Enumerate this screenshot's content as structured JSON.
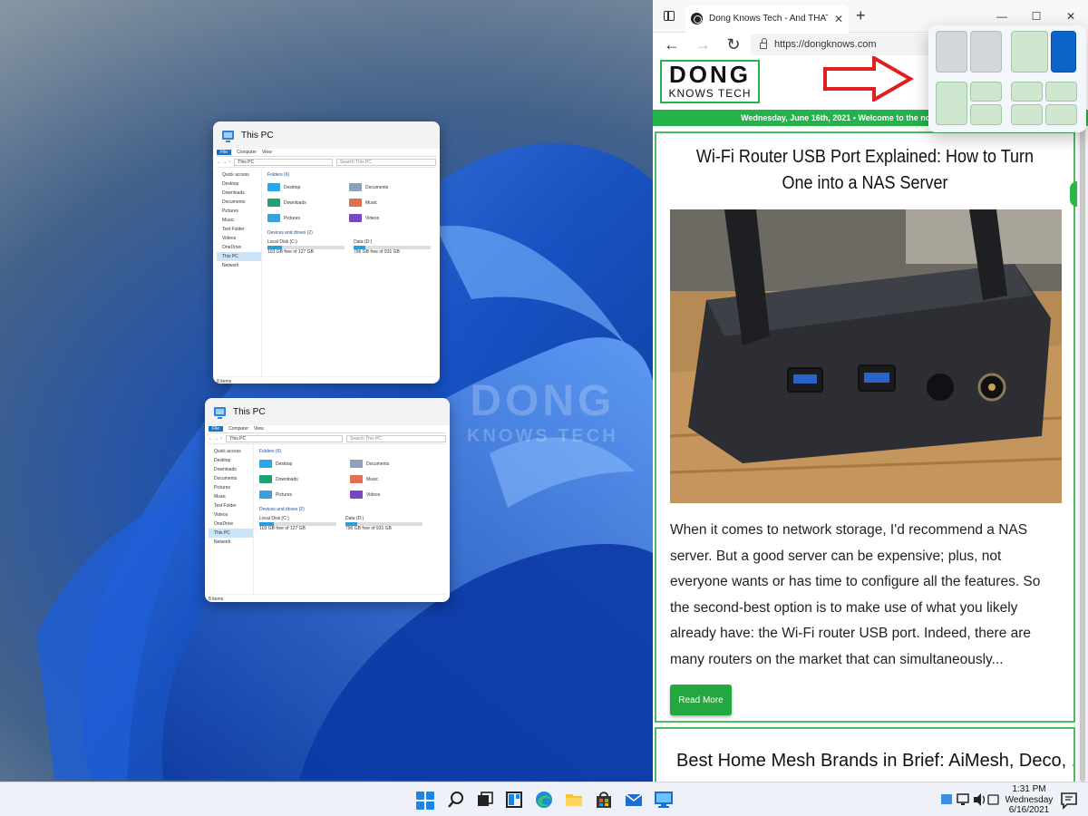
{
  "desktop": {
    "watermark_line1": "DONG",
    "watermark_line2": "KNOWS TECH"
  },
  "explorer_thumbs": [
    {
      "title": "This PC",
      "ribbon": [
        "File",
        "Computer",
        "View"
      ],
      "address": "This PC",
      "search_placeholder": "Search This PC",
      "nav": [
        "Quick access",
        "Desktop",
        "Downloads",
        "Documents",
        "Pictures",
        "Music",
        "Test Folder",
        "Videos",
        "OneDrive",
        "This PC",
        "Network"
      ],
      "folders_header": "Folders (6)",
      "folders": [
        "Desktop",
        "Documents",
        "Downloads",
        "Music",
        "Pictures",
        "Videos"
      ],
      "drives_header": "Devices and drives (2)",
      "drives": [
        {
          "name": "Local Disk (C:)",
          "free": "103 GB free of 127 GB",
          "fill": 0.19
        },
        {
          "name": "Data (D:)",
          "free": "796 GB free of 931 GB",
          "fill": 0.15
        }
      ],
      "status": "8 items"
    },
    {
      "title": "This PC",
      "ribbon": [
        "File",
        "Computer",
        "View"
      ],
      "address": "This PC",
      "search_placeholder": "Search This PC",
      "nav": [
        "Quick access",
        "Desktop",
        "Downloads",
        "Documents",
        "Pictures",
        "Music",
        "Test Folder",
        "Videos",
        "OneDrive",
        "This PC",
        "Network"
      ],
      "folders_header": "Folders (6)",
      "folders": [
        "Desktop",
        "Documents",
        "Downloads",
        "Music",
        "Pictures",
        "Videos"
      ],
      "drives_header": "Devices and drives (2)",
      "drives": [
        {
          "name": "Local Disk (C:)",
          "free": "103 GB free of 127 GB",
          "fill": 0.19
        },
        {
          "name": "Data (D:)",
          "free": "796 GB free of 931 GB",
          "fill": 0.15
        }
      ],
      "status": "8 items"
    }
  ],
  "browser": {
    "tab_title": "Dong Knows Tech - And THAT's a",
    "url": "https://dongknows.com",
    "logo_line1": "DONG",
    "logo_line2": "KNOWS TECH",
    "banner": "Wednesday, June 16th, 2021 • Welcome to the no-nonsense zone! •",
    "article": {
      "title": "Wi-Fi Router USB Port Explained: How to Turn One into a NAS Server",
      "excerpt": "When it comes to network storage, I'd recommend a NAS server. But a good server can be expensive; plus, not everyone wants or has time to configure all the features. So the second-best option is to make use of what you likely already have: the Wi-Fi router USB port. Indeed, there are many routers on the market that can simultaneously...",
      "read_more": "Read More"
    },
    "next_article_title": "Best Home Mesh Brands in Brief: AiMesh, Deco, ..."
  },
  "taskbar": {
    "clock_time": "1:31 PM",
    "clock_day": "Wednesday",
    "clock_date": "6/16/2021"
  },
  "colors": {
    "accent_green": "#24b24a",
    "snap_highlight": "#0c63c8",
    "start_blue": "#1c84e4"
  }
}
